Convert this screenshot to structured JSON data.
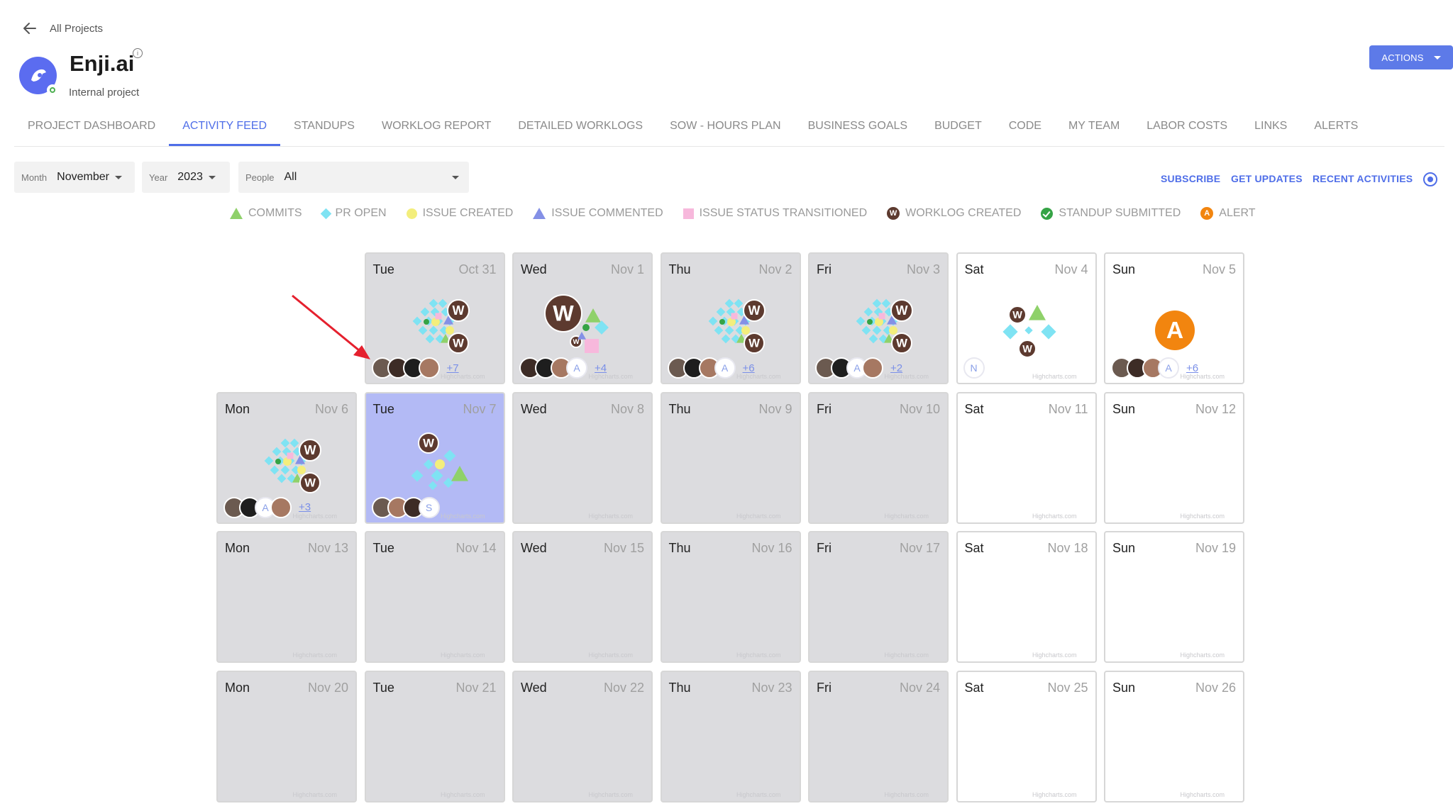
{
  "header": {
    "back_label": "All Projects",
    "title": "Enji.ai",
    "subtitle": "Internal project",
    "actions_label": "ACTIONS"
  },
  "tabs": [
    {
      "label": "PROJECT DASHBOARD",
      "active": false
    },
    {
      "label": "ACTIVITY FEED",
      "active": true
    },
    {
      "label": "STANDUPS",
      "active": false
    },
    {
      "label": "WORKLOG REPORT",
      "active": false
    },
    {
      "label": "DETAILED WORKLOGS",
      "active": false
    },
    {
      "label": "SOW - HOURS PLAN",
      "active": false
    },
    {
      "label": "BUSINESS GOALS",
      "active": false
    },
    {
      "label": "BUDGET",
      "active": false
    },
    {
      "label": "CODE",
      "active": false
    },
    {
      "label": "MY TEAM",
      "active": false
    },
    {
      "label": "LABOR COSTS",
      "active": false
    },
    {
      "label": "LINKS",
      "active": false
    },
    {
      "label": "ALERTS",
      "active": false
    }
  ],
  "filters": {
    "month": {
      "label": "Month",
      "value": "November"
    },
    "year": {
      "label": "Year",
      "value": "2023"
    },
    "people": {
      "label": "People",
      "value": "All"
    }
  },
  "toolbar": {
    "subscribe": "SUBSCRIBE",
    "get_updates": "GET UPDATES",
    "recent_activities": "RECENT ACTIVITIES"
  },
  "legend": [
    {
      "label": "COMMITS",
      "icon": "green-triangle"
    },
    {
      "label": "PR OPEN",
      "icon": "cyan-diamond"
    },
    {
      "label": "ISSUE CREATED",
      "icon": "yellow-circle"
    },
    {
      "label": "ISSUE COMMENTED",
      "icon": "blue-triangle"
    },
    {
      "label": "ISSUE STATUS TRANSITIONED",
      "icon": "pink-square"
    },
    {
      "label": "WORKLOG CREATED",
      "icon": "worklog-w-icon"
    },
    {
      "label": "STANDUP SUBMITTED",
      "icon": "check-icon"
    },
    {
      "label": "ALERT",
      "icon": "alert-a-icon"
    }
  ],
  "colors": {
    "accent": "#4f6ee8",
    "commits": "#8fd16a",
    "pr_open": "#7fe3f3",
    "issue_created": "#f3ee7c",
    "issue_commented": "#8490e6",
    "issue_status": "#f7b8dc",
    "worklog": "#5d3a2f",
    "standup": "#35a345",
    "alert": "#f2850f",
    "weekday_cell": "#dcdcdf",
    "weekend_cell": "#ffffff",
    "today_cell": "#b3baf5"
  },
  "calendar": {
    "watermark": "Highcharts.com",
    "weeks": [
      [
        null,
        {
          "dow": "Tue",
          "date": "Oct 31",
          "kind": "weekday",
          "activity": "dense",
          "avatars": [
            "a1",
            "a2",
            "a3",
            "a4"
          ],
          "more": "+7"
        },
        {
          "dow": "Wed",
          "date": "Nov 1",
          "kind": "weekday",
          "activity": "worklog-big",
          "avatars": [
            "a2",
            "a3",
            "a4",
            "A"
          ],
          "more": "+4"
        },
        {
          "dow": "Thu",
          "date": "Nov 2",
          "kind": "weekday",
          "activity": "dense",
          "avatars": [
            "a1",
            "a3",
            "a4",
            "A"
          ],
          "more": "+6"
        },
        {
          "dow": "Fri",
          "date": "Nov 3",
          "kind": "weekday",
          "activity": "dense",
          "avatars": [
            "a1",
            "a3",
            "A",
            "a4"
          ],
          "more": "+2"
        },
        {
          "dow": "Sat",
          "date": "Nov 4",
          "kind": "weekend",
          "activity": "light",
          "avatars": [
            "N"
          ],
          "more": ""
        },
        {
          "dow": "Sun",
          "date": "Nov 5",
          "kind": "weekend",
          "activity": "alert",
          "avatars": [
            "a1",
            "a2",
            "a4",
            "A"
          ],
          "more": "+6"
        }
      ],
      [
        {
          "dow": "Mon",
          "date": "Nov 6",
          "kind": "weekday",
          "activity": "dense",
          "avatars": [
            "a1",
            "a3",
            "A",
            "a4"
          ],
          "more": "+3"
        },
        {
          "dow": "Tue",
          "date": "Nov 7",
          "kind": "today",
          "activity": "medium",
          "avatars": [
            "a1",
            "a4",
            "a2",
            "S"
          ],
          "more": ""
        },
        {
          "dow": "Wed",
          "date": "Nov 8",
          "kind": "weekday",
          "activity": "",
          "avatars": [],
          "more": ""
        },
        {
          "dow": "Thu",
          "date": "Nov 9",
          "kind": "weekday",
          "activity": "",
          "avatars": [],
          "more": ""
        },
        {
          "dow": "Fri",
          "date": "Nov 10",
          "kind": "weekday",
          "activity": "",
          "avatars": [],
          "more": ""
        },
        {
          "dow": "Sat",
          "date": "Nov 11",
          "kind": "weekend",
          "activity": "",
          "avatars": [],
          "more": ""
        },
        {
          "dow": "Sun",
          "date": "Nov 12",
          "kind": "weekend",
          "activity": "",
          "avatars": [],
          "more": ""
        }
      ],
      [
        {
          "dow": "Mon",
          "date": "Nov 13",
          "kind": "weekday",
          "activity": "",
          "avatars": [],
          "more": ""
        },
        {
          "dow": "Tue",
          "date": "Nov 14",
          "kind": "weekday",
          "activity": "",
          "avatars": [],
          "more": ""
        },
        {
          "dow": "Wed",
          "date": "Nov 15",
          "kind": "weekday",
          "activity": "",
          "avatars": [],
          "more": ""
        },
        {
          "dow": "Thu",
          "date": "Nov 16",
          "kind": "weekday",
          "activity": "",
          "avatars": [],
          "more": ""
        },
        {
          "dow": "Fri",
          "date": "Nov 17",
          "kind": "weekday",
          "activity": "",
          "avatars": [],
          "more": ""
        },
        {
          "dow": "Sat",
          "date": "Nov 18",
          "kind": "weekend",
          "activity": "",
          "avatars": [],
          "more": ""
        },
        {
          "dow": "Sun",
          "date": "Nov 19",
          "kind": "weekend",
          "activity": "",
          "avatars": [],
          "more": ""
        }
      ],
      [
        {
          "dow": "Mon",
          "date": "Nov 20",
          "kind": "weekday",
          "activity": "",
          "avatars": [],
          "more": ""
        },
        {
          "dow": "Tue",
          "date": "Nov 21",
          "kind": "weekday",
          "activity": "",
          "avatars": [],
          "more": ""
        },
        {
          "dow": "Wed",
          "date": "Nov 22",
          "kind": "weekday",
          "activity": "",
          "avatars": [],
          "more": ""
        },
        {
          "dow": "Thu",
          "date": "Nov 23",
          "kind": "weekday",
          "activity": "",
          "avatars": [],
          "more": ""
        },
        {
          "dow": "Fri",
          "date": "Nov 24",
          "kind": "weekday",
          "activity": "",
          "avatars": [],
          "more": ""
        },
        {
          "dow": "Sat",
          "date": "Nov 25",
          "kind": "weekend",
          "activity": "",
          "avatars": [],
          "more": ""
        },
        {
          "dow": "Sun",
          "date": "Nov 26",
          "kind": "weekend",
          "activity": "",
          "avatars": [],
          "more": ""
        }
      ]
    ]
  }
}
